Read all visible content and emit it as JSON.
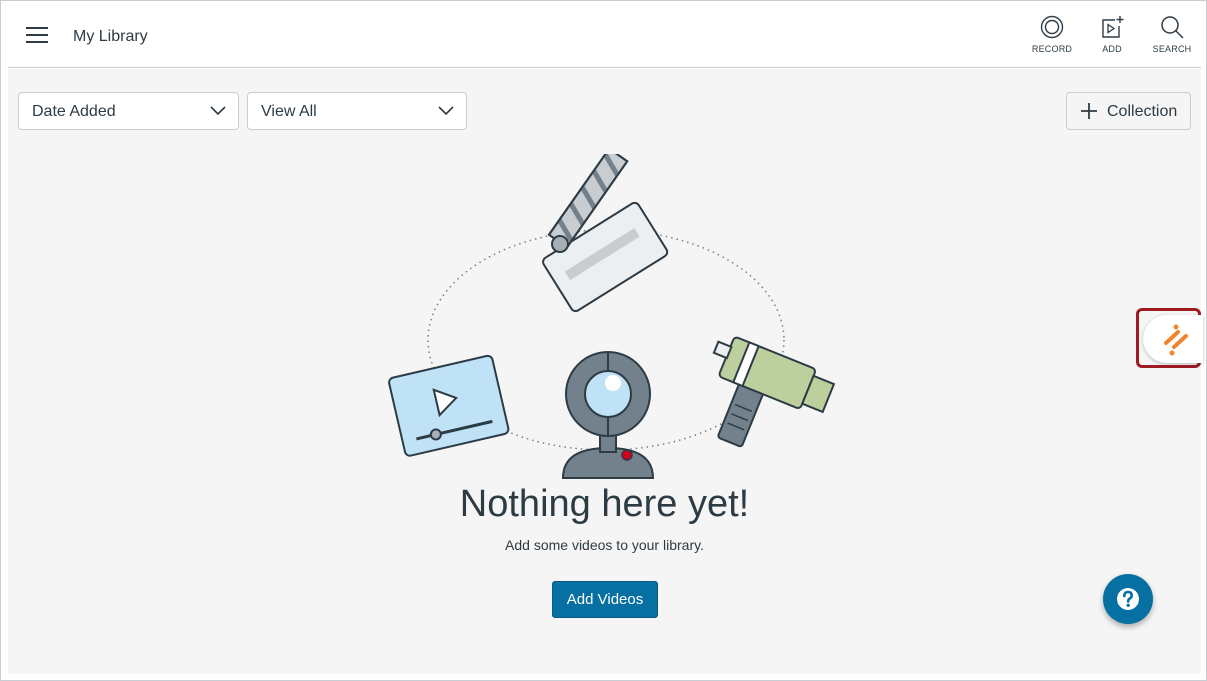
{
  "header": {
    "title": "My Library",
    "tools": [
      {
        "label": "RECORD",
        "icon": "record-icon"
      },
      {
        "label": "ADD",
        "icon": "add-video-icon"
      },
      {
        "label": "SEARCH",
        "icon": "search-icon"
      }
    ]
  },
  "filters": {
    "sort": {
      "value": "Date Added"
    },
    "view": {
      "value": "View All"
    }
  },
  "collection_button": {
    "label": "Collection"
  },
  "empty_state": {
    "title": "Nothing here yet!",
    "subtitle": "Add some videos to your library.",
    "button_label": "Add Videos",
    "illustration_icons": [
      "clapperboard-icon",
      "video-player-icon",
      "camcorder-icon",
      "webcam-icon"
    ]
  },
  "colors": {
    "accent": "#0770a3",
    "text": "#2d3b45",
    "background": "#f5f5f5",
    "widget_border": "#9e1b22",
    "widget_orange": "#f0852d"
  }
}
